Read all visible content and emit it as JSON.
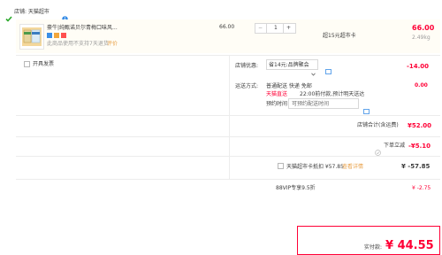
{
  "store": {
    "check_icon": "green-check-icon",
    "name": "店铺: 天猫超市",
    "badge_icon": "blue-info-icon"
  },
  "item": {
    "title": "豪牛|纯甄诺贝尔青梅口味风...",
    "tags_text": "此商品使用不支持7天退货",
    "review": "评价",
    "price": "66.00",
    "qty": "1",
    "minus": "−",
    "plus": "+",
    "shop_label": "超15元超市卡",
    "total": "66.00",
    "weight": "2.49kg"
  },
  "invoice": {
    "label": "开具发票"
  },
  "discount": {
    "label": "店铺优惠:",
    "select_value": "省14元:品牌聚会",
    "select_arrow": "chevron-down-icon",
    "amount": "-14.00"
  },
  "delivery": {
    "label": "运送方式:",
    "line1": "普通配送 快递 免邮",
    "line2_tag": "天猫直送",
    "line2_text": "22:00前付款,预计明天送达",
    "time_label": "预约时间",
    "time_placeholder": "可预约配送时间",
    "amount": "0.00"
  },
  "store_total": {
    "label": "店铺合计(含运费)",
    "amount": "¥52.00"
  },
  "order_discount": {
    "label": "下单立减",
    "amount": "-¥5.10"
  },
  "card": {
    "label": "天猫超市卡抵扣 ¥57.85",
    "link": "查看详情",
    "amount": "¥ -57.85"
  },
  "vip": {
    "label": "88VIP专享9.5折",
    "amount": "¥ -2.75"
  },
  "payment": {
    "label": "实付款:",
    "amount": "¥ 44.55"
  }
}
